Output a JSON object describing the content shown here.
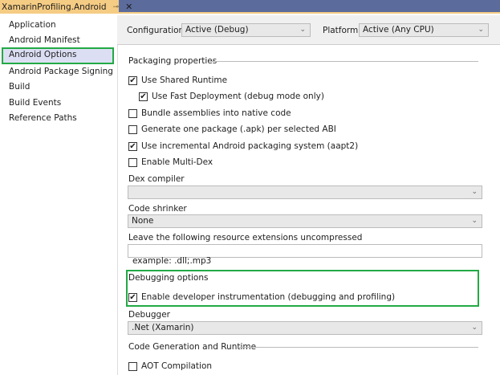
{
  "tab": {
    "title": "XamarinProfiling.Android",
    "pin": "⊸",
    "close": "✕"
  },
  "sidebar": {
    "items": [
      {
        "label": "Application"
      },
      {
        "label": "Android Manifest"
      },
      {
        "label": "Android Options",
        "selected": true
      },
      {
        "label": "Android Package Signing"
      },
      {
        "label": "Build"
      },
      {
        "label": "Build Events"
      },
      {
        "label": "Reference Paths"
      }
    ]
  },
  "config": {
    "configuration_label": "Configuration:",
    "configuration_value": "Active (Debug)",
    "platform_label": "Platform:",
    "platform_value": "Active (Any CPU)"
  },
  "packaging": {
    "title": "Packaging properties",
    "options": [
      {
        "label": "Use Shared Runtime",
        "checked": true
      },
      {
        "label": "Use Fast Deployment (debug mode only)",
        "checked": true
      },
      {
        "label": "Bundle assemblies into native code",
        "checked": false
      },
      {
        "label": "Generate one package (.apk) per selected ABI",
        "checked": false
      },
      {
        "label": "Use incremental Android packaging system (aapt2)",
        "checked": true
      },
      {
        "label": "Enable Multi-Dex",
        "checked": false
      }
    ],
    "dex_label": "Dex compiler",
    "dex_value": "",
    "shrinker_label": "Code shrinker",
    "shrinker_value": "None",
    "uncompressed_label": "Leave the following resource extensions uncompressed",
    "uncompressed_value": "",
    "example": "example: .dll;.mp3"
  },
  "debugging": {
    "title": "Debugging options",
    "instrumentation_label": "Enable developer instrumentation (debugging and profiling)",
    "instrumentation_checked": true,
    "debugger_label": "Debugger",
    "debugger_value": ".Net (Xamarin)"
  },
  "codegen": {
    "title": "Code Generation and Runtime",
    "aot_label": "AOT Compilation",
    "aot_checked": false
  },
  "check": "✔",
  "chev": "⌄"
}
